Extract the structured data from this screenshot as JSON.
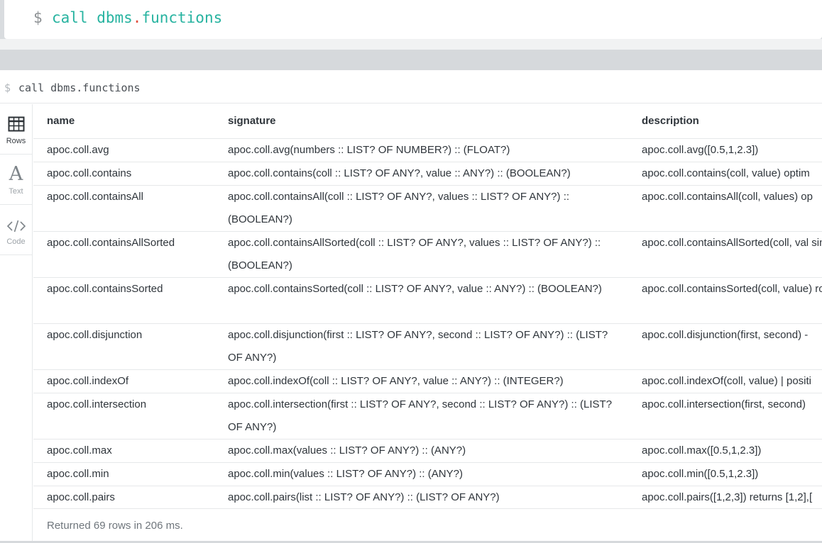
{
  "editor": {
    "prompt": "$",
    "command_prefix": "call dbms",
    "command_dot": ".",
    "command_suffix": "functions"
  },
  "frame": {
    "prompt": "$",
    "command": "call dbms.functions",
    "tabs": [
      {
        "label": "Rows",
        "icon": "table-icon"
      },
      {
        "label": "Text",
        "icon": "text-icon"
      },
      {
        "label": "Code",
        "icon": "code-icon"
      }
    ],
    "columns": [
      "name",
      "signature",
      "description"
    ],
    "rows": [
      {
        "name": "apoc.coll.avg",
        "signature": "apoc.coll.avg(numbers :: LIST? OF NUMBER?) :: (FLOAT?)",
        "description": "apoc.coll.avg([0.5,1,2.3])"
      },
      {
        "name": "apoc.coll.contains",
        "signature": "apoc.coll.contains(coll :: LIST? OF ANY?, value :: ANY?) :: (BOOLEAN?)",
        "description": "apoc.coll.contains(coll, value) optim"
      },
      {
        "name": "apoc.coll.containsAll",
        "signature": "apoc.coll.containsAll(coll :: LIST? OF ANY?, values :: LIST? OF ANY?) :: (BOOLEAN?)",
        "description": "apoc.coll.containsAll(coll, values) op"
      },
      {
        "name": "apoc.coll.containsAllSorted",
        "signature": "apoc.coll.containsAllSorted(coll :: LIST? OF ANY?, values :: LIST? OF ANY?) :: (BOOLEAN?)",
        "description": "apoc.coll.containsAllSorted(coll, val single row or not)"
      },
      {
        "name": "apoc.coll.containsSorted",
        "signature": "apoc.coll.containsSorted(coll :: LIST? OF ANY?, value :: ANY?) :: (BOOLEAN?)",
        "description": "apoc.coll.containsSorted(coll, value) row or not)"
      },
      {
        "name": "apoc.coll.disjunction",
        "signature": "apoc.coll.disjunction(first :: LIST? OF ANY?, second :: LIST? OF ANY?) :: (LIST? OF ANY?)",
        "description": "apoc.coll.disjunction(first, second) -"
      },
      {
        "name": "apoc.coll.indexOf",
        "signature": "apoc.coll.indexOf(coll :: LIST? OF ANY?, value :: ANY?) :: (INTEGER?)",
        "description": "apoc.coll.indexOf(coll, value) | positi"
      },
      {
        "name": "apoc.coll.intersection",
        "signature": "apoc.coll.intersection(first :: LIST? OF ANY?, second :: LIST? OF ANY?) :: (LIST? OF ANY?)",
        "description": "apoc.coll.intersection(first, second)"
      },
      {
        "name": "apoc.coll.max",
        "signature": "apoc.coll.max(values :: LIST? OF ANY?) :: (ANY?)",
        "description": "apoc.coll.max([0.5,1,2.3])"
      },
      {
        "name": "apoc.coll.min",
        "signature": "apoc.coll.min(values :: LIST? OF ANY?) :: (ANY?)",
        "description": "apoc.coll.min([0.5,1,2.3])"
      },
      {
        "name": "apoc.coll.pairs",
        "signature": "apoc.coll.pairs(list :: LIST? OF ANY?) :: (LIST? OF ANY?)",
        "description": "apoc.coll.pairs([1,2,3]) returns [1,2],["
      }
    ],
    "footer": "Returned 69 rows in 206 ms."
  }
}
